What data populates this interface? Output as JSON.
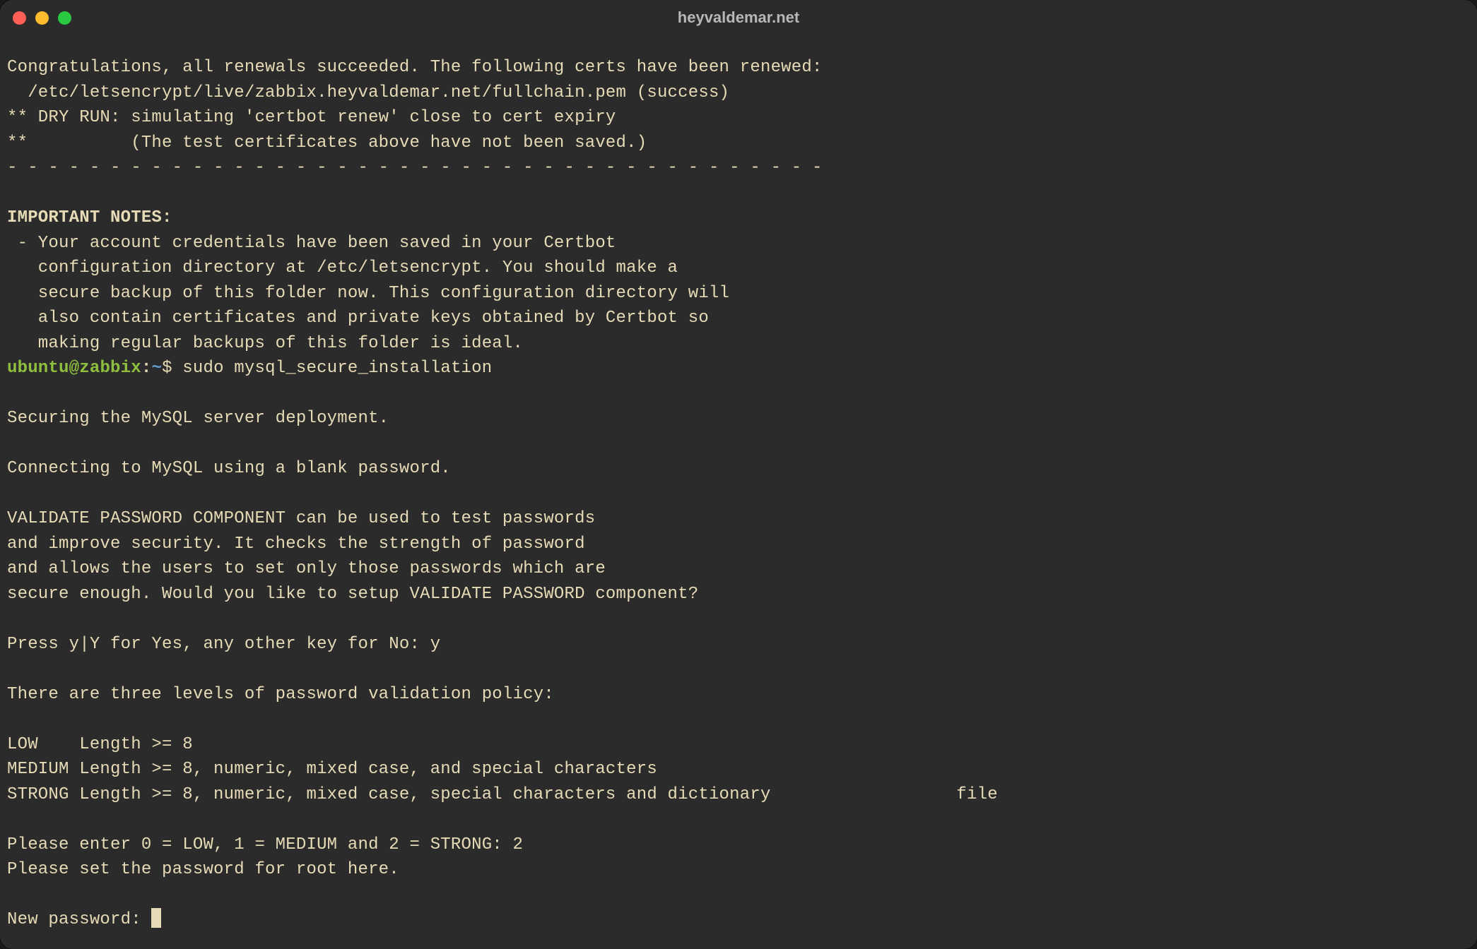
{
  "window": {
    "title": "heyvaldemar.net"
  },
  "terminal": {
    "line1": "Congratulations, all renewals succeeded. The following certs have been renewed:",
    "line2": "  /etc/letsencrypt/live/zabbix.heyvaldemar.net/fullchain.pem (success)",
    "line3": "** DRY RUN: simulating 'certbot renew' close to cert expiry",
    "line4": "**          (The test certificates above have not been saved.)",
    "line5": "- - - - - - - - - - - - - - - - - - - - - - - - - - - - - - - - - - - - - - - -",
    "line6": "",
    "notes_header": "IMPORTANT NOTES:",
    "line8": " - Your account credentials have been saved in your Certbot",
    "line9": "   configuration directory at /etc/letsencrypt. You should make a",
    "line10": "   secure backup of this folder now. This configuration directory will",
    "line11": "   also contain certificates and private keys obtained by Certbot so",
    "line12": "   making regular backups of this folder is ideal.",
    "prompt": {
      "user": "ubuntu",
      "at": "@",
      "host": "zabbix",
      "colon": ":",
      "path": "~",
      "dollar": "$ ",
      "command": "sudo mysql_secure_installation"
    },
    "line14": "",
    "line15": "Securing the MySQL server deployment.",
    "line16": "",
    "line17": "Connecting to MySQL using a blank password.",
    "line18": "",
    "line19": "VALIDATE PASSWORD COMPONENT can be used to test passwords",
    "line20": "and improve security. It checks the strength of password",
    "line21": "and allows the users to set only those passwords which are",
    "line22": "secure enough. Would you like to setup VALIDATE PASSWORD component?",
    "line23": "",
    "line24": "Press y|Y for Yes, any other key for No: y",
    "line25": "",
    "line26": "There are three levels of password validation policy:",
    "line27": "",
    "line28": "LOW    Length >= 8",
    "line29": "MEDIUM Length >= 8, numeric, mixed case, and special characters",
    "line30": "STRONG Length >= 8, numeric, mixed case, special characters and dictionary                  file",
    "line31": "",
    "line32": "Please enter 0 = LOW, 1 = MEDIUM and 2 = STRONG: 2",
    "line33": "Please set the password for root here.",
    "line34": "",
    "line35": "New password: "
  }
}
